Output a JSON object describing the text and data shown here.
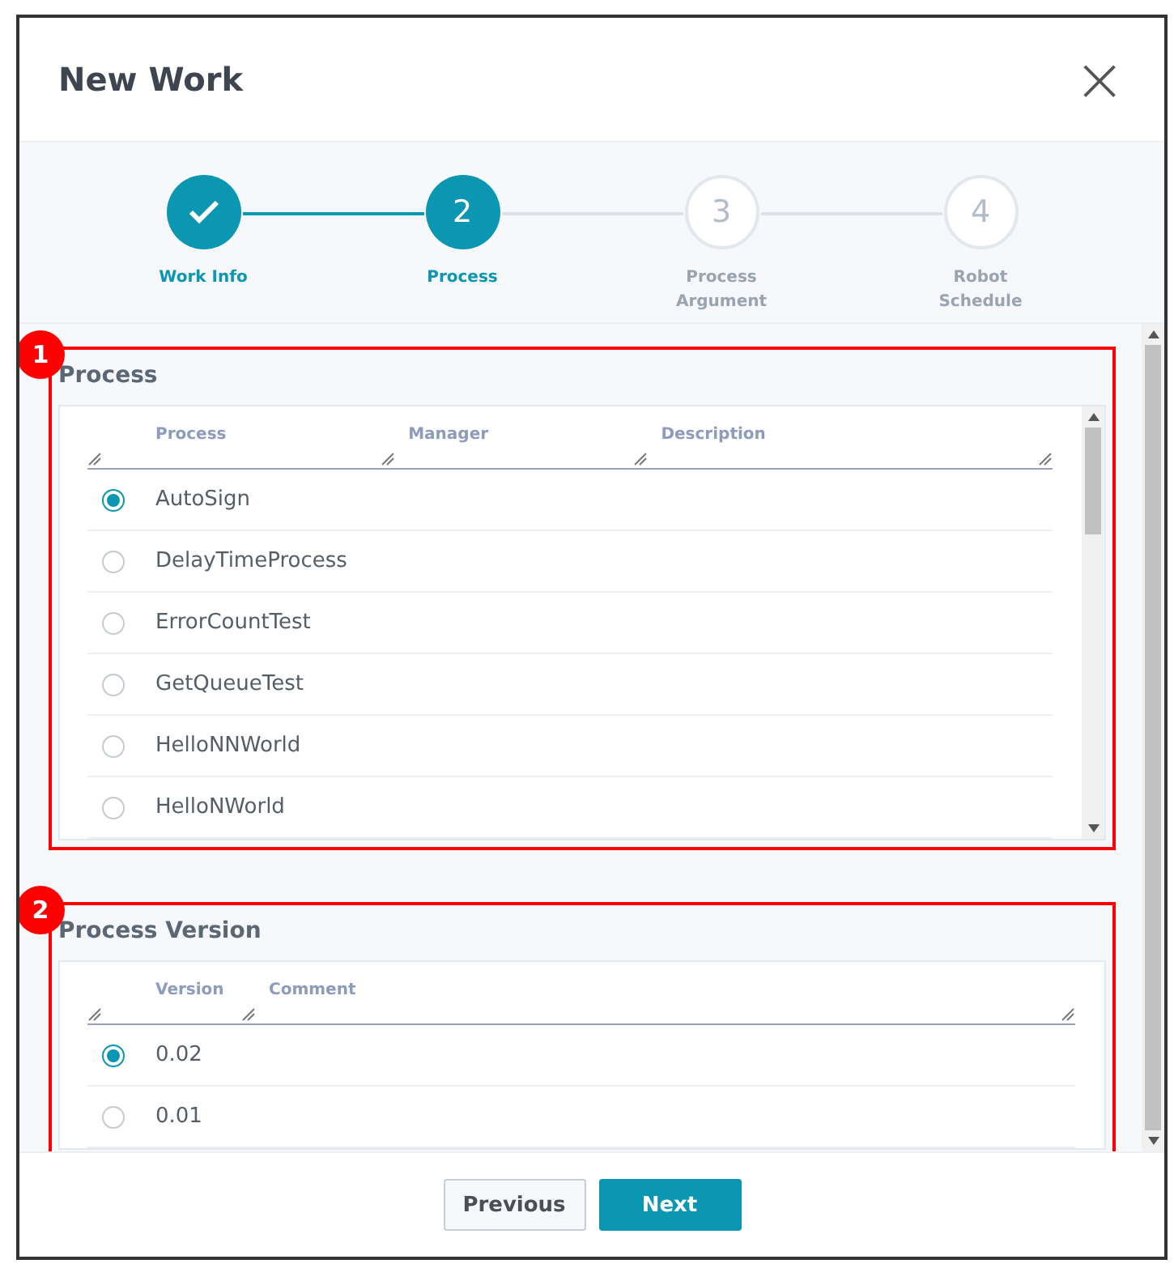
{
  "dialog": {
    "title": "New Work",
    "close": "×"
  },
  "steps": [
    {
      "label": "Work Info",
      "completed": true,
      "selected": false
    },
    {
      "number": "2",
      "label": "Process",
      "completed": false,
      "selected": true
    },
    {
      "number": "3",
      "label": "Process Argument",
      "completed": false,
      "selected": false
    },
    {
      "number": "4",
      "label": "Robot Schedule",
      "completed": false,
      "selected": false
    }
  ],
  "sections": [
    {
      "badge": "1",
      "title": "Process",
      "columns": [
        "Process",
        "Manager",
        "Description"
      ],
      "rows": [
        {
          "name": "AutoSign",
          "selected": true
        },
        {
          "name": "DelayTimeProcess",
          "selected": false
        },
        {
          "name": "ErrorCountTest",
          "selected": false
        },
        {
          "name": "GetQueueTest",
          "selected": false
        },
        {
          "name": "HelloNNWorld",
          "selected": false
        },
        {
          "name": "HelloNWorld",
          "selected": false
        }
      ]
    },
    {
      "badge": "2",
      "title": "Process Version",
      "columns": [
        "Version",
        "Comment"
      ],
      "rows": [
        {
          "name": "0.02",
          "selected": true
        },
        {
          "name": "0.01",
          "selected": false
        }
      ]
    }
  ],
  "buttons": [
    {
      "label": "Previous",
      "kind": "secondary"
    },
    {
      "label": "Next",
      "kind": "primary"
    }
  ]
}
